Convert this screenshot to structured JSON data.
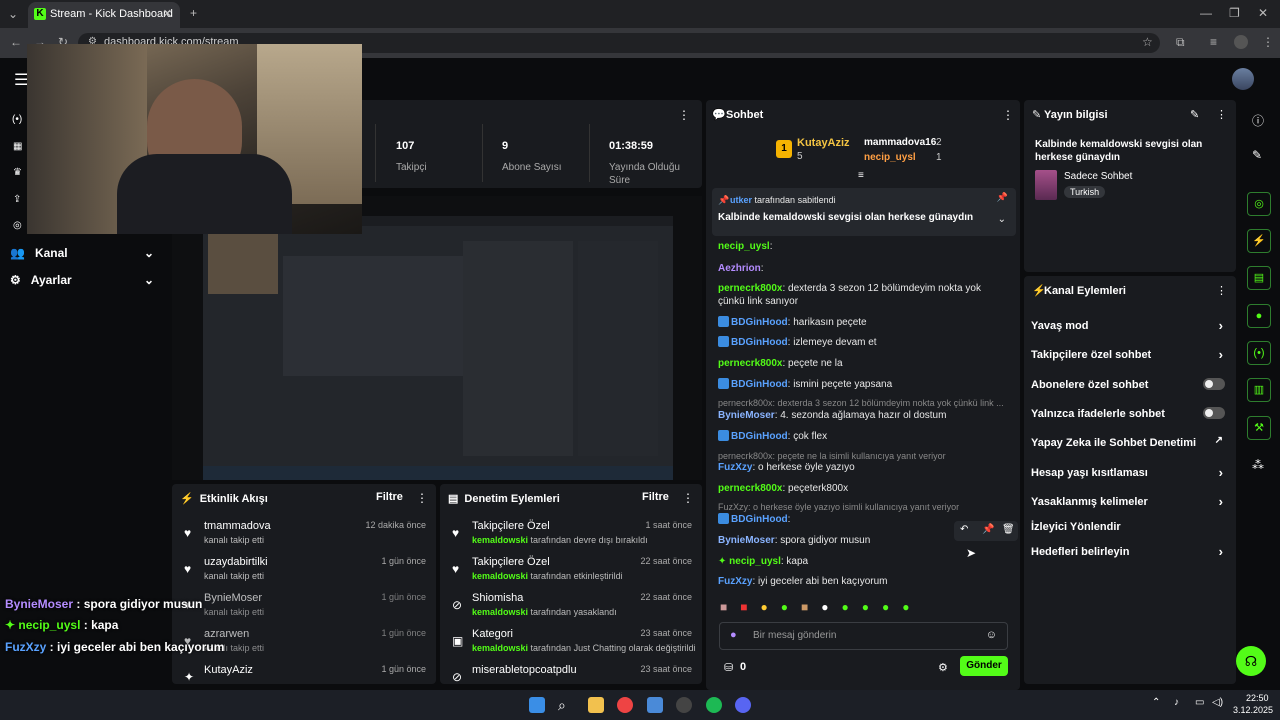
{
  "browser": {
    "tab_title": "Stream - Kick Dashboard",
    "url": "dashboard.kick.com/stream"
  },
  "nav": {
    "kanal": "Kanal",
    "ayarlar": "Ayarlar"
  },
  "stats": [
    {
      "value": "107",
      "label": "Takipçi"
    },
    {
      "value": "9",
      "label": "Abone Sayısı"
    },
    {
      "value": "01:38:59",
      "label": "Yayında Olduğu Süre"
    }
  ],
  "activity": {
    "title": "Etkinlik Akışı",
    "filter": "Filtre",
    "rows": [
      {
        "name": "tmammadova",
        "sub": "kanalı takip etti",
        "time": "12 dakika önce"
      },
      {
        "name": "uzaydabirtilki",
        "sub": "kanalı takip etti",
        "time": "1 gün önce"
      },
      {
        "name": "BynieMoser",
        "sub": "kanalı takip etti",
        "time": "1 gün önce"
      },
      {
        "name": "azrarwen",
        "sub": "kanalı takip etti",
        "time": "1 gün önce"
      },
      {
        "name": "KutayAziz",
        "sub": "",
        "time": "1 gün önce"
      }
    ]
  },
  "moderation": {
    "title": "Denetim Eylemleri",
    "filter": "Filtre",
    "rows": [
      {
        "name": "Takipçilere Özel",
        "user": "kemaldowski",
        "sub": " tarafından devre dışı bırakıldı",
        "time": "1 saat önce"
      },
      {
        "name": "Takipçilere Özel",
        "user": "kemaldowski",
        "sub": " tarafından etkinleştirildi",
        "time": "22 saat önce"
      },
      {
        "name": "Shiomisha",
        "user": "kemaldowski",
        "sub": " tarafından yasaklandı",
        "time": "22 saat önce"
      },
      {
        "name": "Kategori",
        "user": "kemaldowski",
        "sub": " tarafından Just Chatting olarak değiştirildi",
        "time": "23 saat önce"
      },
      {
        "name": "miserabletopcoatpdlu",
        "user": "",
        "sub": "",
        "time": "23 saat önce"
      }
    ]
  },
  "chat": {
    "title": "Sohbet",
    "top": {
      "first": "KutayAziz",
      "first_count": "5",
      "second": "mammadova16",
      "second_count": "2",
      "third": "necip_uysl",
      "third_count": "1"
    },
    "pinned_by": "utker",
    "pinned_by_suffix": "tarafından sabitlendi",
    "pinned_text": "Kalbinde kemaldowski sevgisi olan herkese günaydın",
    "messages": [
      {
        "user": "necip_uysl",
        "text": ":",
        "color": "green"
      },
      {
        "user": "Aezhrion",
        "text": ":",
        "color": "purple"
      },
      {
        "user": "pernecrk800x",
        "text": ": dexterda 3 sezon 12 bölümdeyim nokta yok çünkü link sanıyor",
        "color": "green"
      },
      {
        "user": "BDGinHood",
        "text": ": harikasın peçete",
        "color": "blue"
      },
      {
        "user": "BDGinHood",
        "text": ": izlemeye devam et",
        "color": "blue"
      },
      {
        "user": "pernecrk800x",
        "text": ": peçete ne la",
        "color": "green"
      },
      {
        "user": "BDGinHood",
        "text": ": ismini peçete yapsana",
        "color": "blue"
      },
      {
        "reply": "pernecrk800x: dexterda 3 sezon 12 bölümdeyim nokta yok çünkü link ..."
      },
      {
        "user": "BynieMoser",
        "text": ": 4. sezonda ağlamaya hazır ol dostum",
        "color": "lblue"
      },
      {
        "user": "BDGinHood",
        "text": ": çok flex",
        "color": "blue"
      },
      {
        "reply": "pernecrk800x: peçete ne la isimli kullanıcıya yanıt veriyor"
      },
      {
        "user": "FuzXzy",
        "text": ": o herkese öyle yazıyo",
        "color": "blue"
      },
      {
        "user": "pernecrk800x",
        "text": ": peçeterk800x",
        "color": "green"
      },
      {
        "reply": "FuzXzy: o herkese öyle yazıyo isimli kullanıcıya yanıt veriyor"
      },
      {
        "user": "BDGinHood",
        "text": ":",
        "color": "blue"
      },
      {
        "user": "BynieMoser",
        "text": ": spora gidiyor musun",
        "color": "lblue"
      },
      {
        "user": "necip_uysl",
        "text": ": kapa",
        "color": "green"
      },
      {
        "user": "FuzXzy",
        "text": ": iyi geceler abi ben kaçıyorum",
        "color": "blue"
      }
    ],
    "input_placeholder": "Bir mesaj gönderin",
    "points": "0",
    "send": "Gönder"
  },
  "info": {
    "title": "Yayın bilgisi",
    "stream_title": "Kalbinde kemaldowski sevgisi olan herkese günaydın",
    "category": "Sadece Sohbet",
    "tag": "Turkish"
  },
  "actions": {
    "title": "Kanal Eylemleri",
    "items": [
      {
        "label": "Yavaş mod",
        "kind": "chevron"
      },
      {
        "label": "Takipçilere özel sohbet",
        "kind": "chevron"
      },
      {
        "label": "Abonelere özel sohbet",
        "kind": "toggle"
      },
      {
        "label": "Yalnızca ifadelerle sohbet",
        "kind": "toggle"
      },
      {
        "label": "Yapay Zeka ile Sohbet Denetimi",
        "kind": "external"
      },
      {
        "label": "Hesap yaşı kısıtlaması",
        "kind": "chevron"
      },
      {
        "label": "Yasaklanmış kelimeler",
        "kind": "chevron"
      },
      {
        "label": "İzleyici Yönlendir",
        "kind": "none"
      },
      {
        "label": "Hedefleri belirleyin",
        "kind": "chevron"
      }
    ]
  },
  "overlay": [
    {
      "user": "BynieMoser",
      "text": " : spora gidiyor musun",
      "color": "#b48cff"
    },
    {
      "user": "necip_uysl",
      "text": " : kapa",
      "color": "#53fc18"
    },
    {
      "user": "FuzXzy",
      "text": " : iyi geceler abi ben kaçıyorum",
      "color": "#5aa2ff"
    }
  ],
  "clock": {
    "time": "22:50",
    "date": "3.12.2025"
  },
  "colors": {
    "accent": "#53fc18",
    "panel": "#191b1f",
    "background": "#0b0c0e"
  }
}
